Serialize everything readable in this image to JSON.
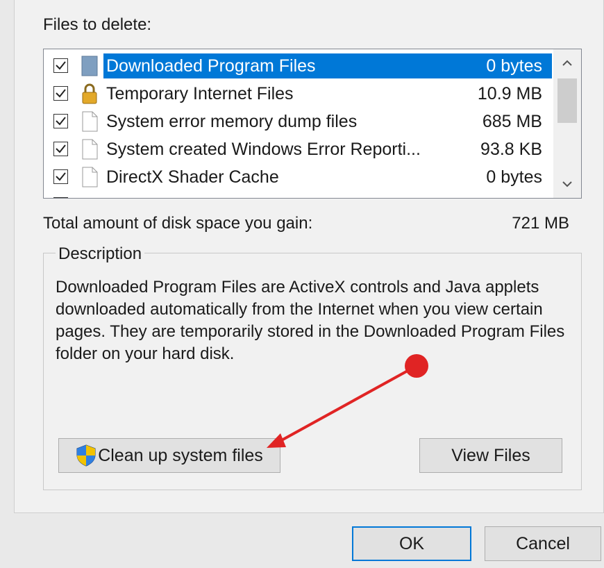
{
  "files_label": "Files to delete:",
  "file_list": [
    {
      "name": "Downloaded Program Files",
      "size": "0 bytes",
      "checked": true,
      "selected": true,
      "icon": "downloaded-program-files-icon"
    },
    {
      "name": "Temporary Internet Files",
      "size": "10.9 MB",
      "checked": true,
      "selected": false,
      "icon": "lock-icon"
    },
    {
      "name": "System error memory dump files",
      "size": "685 MB",
      "checked": true,
      "selected": false,
      "icon": "file-icon"
    },
    {
      "name": "System created Windows Error Reporti...",
      "size": "93.8 KB",
      "checked": true,
      "selected": false,
      "icon": "file-icon"
    },
    {
      "name": "DirectX Shader Cache",
      "size": "0 bytes",
      "checked": true,
      "selected": false,
      "icon": "file-icon"
    }
  ],
  "total_label": "Total amount of disk space you gain:",
  "total_value": "721 MB",
  "description": {
    "title": "Description",
    "text": "Downloaded Program Files are ActiveX controls and Java applets downloaded automatically from the Internet when you view certain pages. They are temporarily stored in the Downloaded Program Files folder on your hard disk."
  },
  "buttons": {
    "cleanup": "Clean up system files",
    "view_files": "View Files",
    "ok": "OK",
    "cancel": "Cancel"
  },
  "colors": {
    "selection": "#0078d7",
    "annotation_arrow": "#e02424",
    "dialog_bg": "#f1f1f1"
  }
}
